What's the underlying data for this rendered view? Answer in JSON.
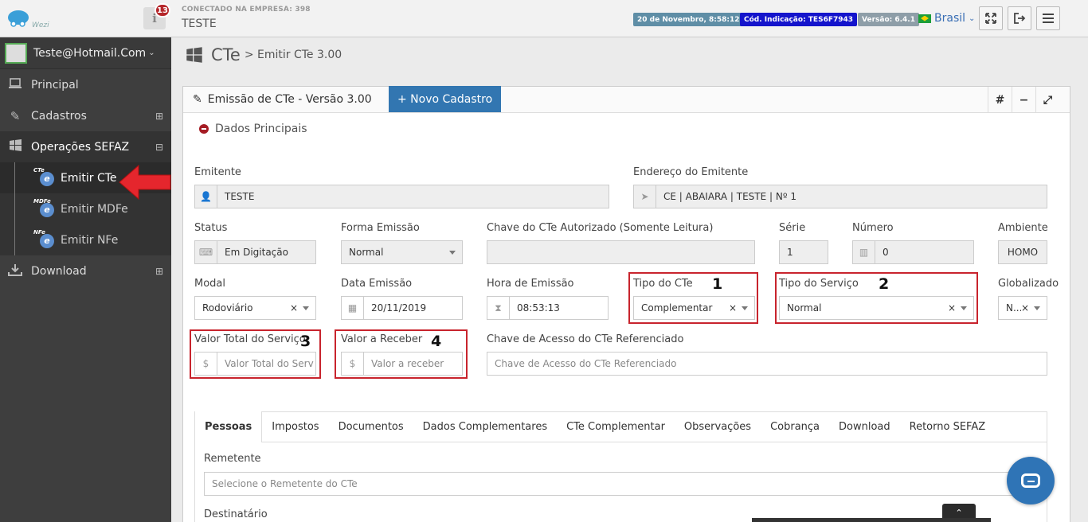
{
  "topbar": {
    "logo_text": "Wezi",
    "notifications_count": "13",
    "connected_label": "CONECTADO NA EMPRESA: 398",
    "company_name": "TESTE",
    "datetime": "20 de Novembro, 8:58:12",
    "indication_code": "Cód. Indicação: TES6F7943",
    "version": "Versão: 6.4.1",
    "language": "Brasil",
    "colors": {
      "date_badge": "#5f8ea6",
      "code_badge": "#1414cc",
      "version_badge": "#8e9ea8"
    }
  },
  "sidebar": {
    "user": "Teste@Hotmail.Com",
    "items": [
      {
        "label": "Principal",
        "icon": "laptop-icon"
      },
      {
        "label": "Cadastros",
        "icon": "edit-icon",
        "toggle": "⊞"
      },
      {
        "label": "Operações SEFAZ",
        "icon": "windows-icon",
        "toggle": "⊟"
      },
      {
        "label": "Download",
        "icon": "download-icon",
        "toggle": "⊞"
      }
    ],
    "sub_items": [
      {
        "label": "Emitir CTe",
        "tag": "CTe"
      },
      {
        "label": "Emitir MDFe",
        "tag": "MDFe"
      },
      {
        "label": "Emitir NFe",
        "tag": "NFe"
      }
    ]
  },
  "breadcrumb": {
    "root": "CTe",
    "current": "> Emitir CTe 3.00"
  },
  "panel": {
    "title": "Emissão de CTe - Versão 3.00",
    "new_button": "+ Novo Cadastro",
    "hash_button": "#",
    "minus_button": "−",
    "expand_button": "⤢",
    "section": "Dados Principais"
  },
  "form": {
    "emitente": {
      "label": "Emitente",
      "value": "TESTE"
    },
    "endereco": {
      "label": "Endereço do Emitente",
      "value": "CE | ABAIARA | TESTE | Nº 1"
    },
    "status": {
      "label": "Status",
      "value": "Em Digitação"
    },
    "forma_emissao": {
      "label": "Forma Emissão",
      "value": "Normal"
    },
    "chave_autorizado": {
      "label": "Chave do CTe Autorizado (Somente Leitura)",
      "value": ""
    },
    "serie": {
      "label": "Série",
      "value": "1"
    },
    "numero": {
      "label": "Número",
      "value": "0"
    },
    "ambiente": {
      "label": "Ambiente",
      "value": "HOMO"
    },
    "modal": {
      "label": "Modal",
      "value": "Rodoviário"
    },
    "data_emissao": {
      "label": "Data Emissão",
      "value": "20/11/2019"
    },
    "hora_emissao": {
      "label": "Hora de Emissão",
      "value": "08:53:13"
    },
    "tipo_cte": {
      "label": "Tipo do CTe",
      "value": "Complementar"
    },
    "tipo_servico": {
      "label": "Tipo do Serviço",
      "value": "Normal"
    },
    "globalizado": {
      "label": "Globalizado",
      "value": "N..."
    },
    "valor_total": {
      "label": "Valor Total do Serviço",
      "placeholder": "Valor Total do Serv"
    },
    "valor_receber": {
      "label": "Valor a Receber",
      "placeholder": "Valor a receber"
    },
    "chave_referenciado": {
      "label": "Chave de Acesso do CTe Referenciado",
      "placeholder": "Chave de Acesso do CTe Referenciado"
    }
  },
  "annotations": [
    "1",
    "2",
    "3",
    "4"
  ],
  "tabs": [
    "Pessoas",
    "Impostos",
    "Documentos",
    "Dados Complementares",
    "CTe Complementar",
    "Observações",
    "Cobrança",
    "Download",
    "Retorno SEFAZ"
  ],
  "pessoas": {
    "remetente_label": "Remetente",
    "remetente_placeholder": "Selecione o Remetente do CTe",
    "destinatario_label": "Destinatário"
  }
}
